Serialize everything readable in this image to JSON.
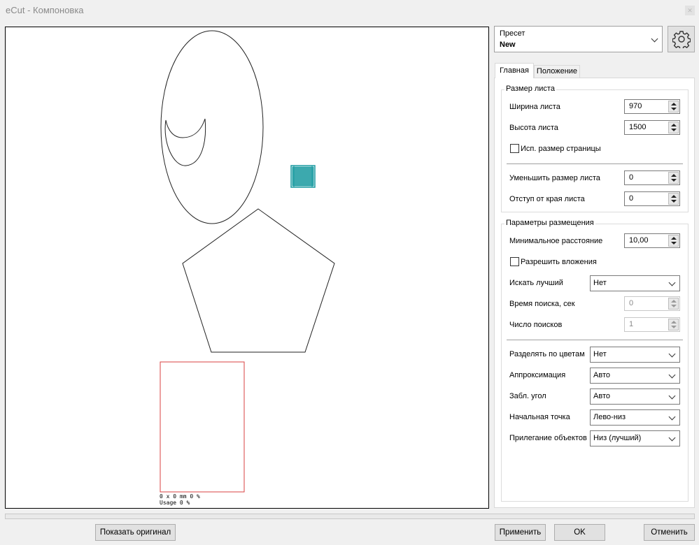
{
  "window": {
    "title": "eCut - Компоновка"
  },
  "canvas": {
    "sheet_info_line1": "0 x 0 mm     0 %",
    "sheet_info_line2": "Usage 0 %"
  },
  "preset": {
    "label": "Пресет",
    "value": "New"
  },
  "tabs": {
    "main": "Главная",
    "position": "Положение"
  },
  "sheet_size": {
    "title": "Размер листа",
    "width_label": "Ширина листа",
    "width_value": "970",
    "height_label": "Высота листа",
    "height_value": "1500",
    "use_page_size_label": "Исп. размер страницы",
    "reduce_label": "Уменьшить размер листа",
    "reduce_value": "0",
    "margin_label": "Отступ от края листа",
    "margin_value": "0"
  },
  "placement": {
    "title": "Параметры размещения",
    "min_distance_label": "Минимальное расстояние",
    "min_distance_value": "10,00",
    "allow_nesting_label": "Разрешить вложения",
    "find_best_label": "Искать лучший",
    "find_best_value": "Нет",
    "search_time_label": "Время поиска, сек",
    "search_time_value": "0",
    "search_count_label": "Число поисков",
    "search_count_value": "1",
    "split_colors_label": "Разделять по цветам",
    "split_colors_value": "Нет",
    "approx_label": "Аппроксимация",
    "approx_value": "Авто",
    "lock_angle_label": "Забл. угол",
    "lock_angle_value": "Авто",
    "start_point_label": "Начальная точка",
    "start_point_value": "Лево-низ",
    "fit_label": "Прилегание объектов",
    "fit_value": "Низ (лучший)"
  },
  "buttons": {
    "show_original": "Показать оригинал",
    "apply": "Применить",
    "ok": "OK",
    "cancel": "Отменить"
  },
  "colors": {
    "selection": "#1a9aa0",
    "sheet_outline": "#d94040"
  }
}
